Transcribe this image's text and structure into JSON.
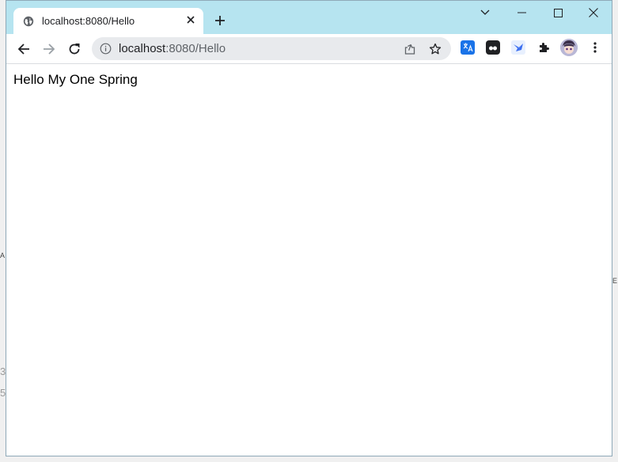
{
  "browser": {
    "tab": {
      "title": "localhost:8080/Hello"
    },
    "address_bar": {
      "host": "localhost",
      "path": ":8080/Hello"
    },
    "extensions": [
      "translate-extension-icon",
      "tampermonkey-extension-icon",
      "bird-extension-icon",
      "puzzle-extensions-icon",
      "profile-avatar"
    ]
  },
  "page": {
    "body_text": "Hello My One Spring"
  },
  "background": {
    "left_text_1": "3",
    "left_text_2": "5",
    "left_text_3": "A",
    "right_text_1": "E"
  },
  "colors": {
    "titlebar": "#b6e4f0",
    "omnibox": "#e8eaed",
    "translate_ext": "#1a73e8"
  }
}
